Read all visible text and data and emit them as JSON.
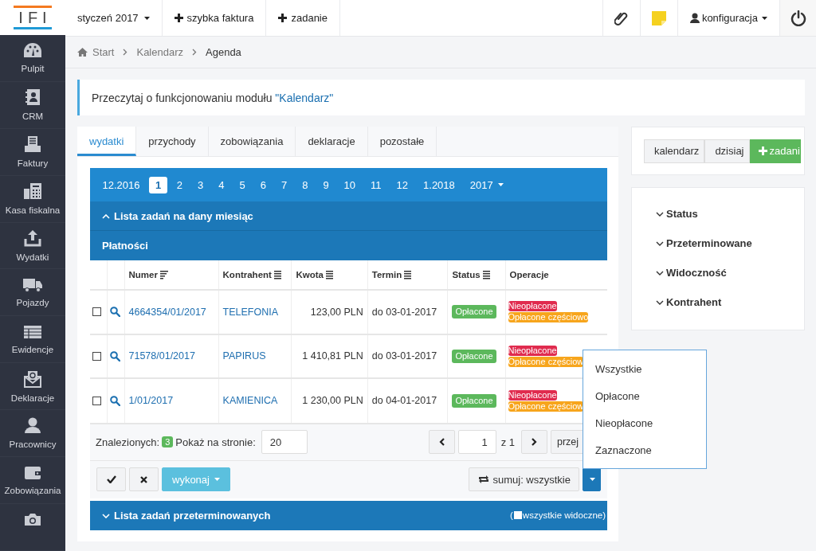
{
  "topbar": {
    "logo": "IFI",
    "month": "styczeń 2017",
    "actions": [
      "szybka faktura",
      "zadanie"
    ],
    "user": "konfiguracja"
  },
  "sidebar": {
    "items": [
      {
        "label": "Pulpit"
      },
      {
        "label": "CRM"
      },
      {
        "label": "Faktury"
      },
      {
        "label": "Kasa fiskalna"
      },
      {
        "label": "Wydatki"
      },
      {
        "label": "Pojazdy"
      },
      {
        "label": "Ewidencje"
      },
      {
        "label": "Deklaracje"
      },
      {
        "label": "Pracownicy"
      },
      {
        "label": "Zobowiązania"
      },
      {
        "kind": "cut"
      }
    ]
  },
  "breadcrumb": [
    "Start",
    "Kalendarz",
    "Agenda"
  ],
  "info": {
    "text": "Przeczytaj o funkcjonowaniu modułu ",
    "link": "\"Kalendarz\""
  },
  "tabs": [
    {
      "label": "wydatki",
      "selected": true
    },
    {
      "label": "przychody",
      "selected": false
    },
    {
      "label": "zobowiązania",
      "selected": false
    },
    {
      "label": "deklaracje",
      "selected": false
    },
    {
      "label": "pozostałe",
      "selected": false
    }
  ],
  "months": [
    {
      "label": "12.2016",
      "selected": false
    },
    {
      "label": "1",
      "selected": true
    },
    {
      "label": "2",
      "selected": false
    },
    {
      "label": "3",
      "selected": false
    },
    {
      "label": "4",
      "selected": false
    },
    {
      "label": "5",
      "selected": false
    },
    {
      "label": "6",
      "selected": false
    },
    {
      "label": "7",
      "selected": false
    },
    {
      "label": "8",
      "selected": false
    },
    {
      "label": "9",
      "selected": false
    },
    {
      "label": "10",
      "selected": false
    },
    {
      "label": "11",
      "selected": false
    },
    {
      "label": "12",
      "selected": false
    },
    {
      "label": "1.2018",
      "selected": false
    }
  ],
  "year": "2017",
  "section_title": "Lista zadań na dany miesiąc",
  "section_expanded": true,
  "subsection": "Płatności",
  "table": {
    "columns": [
      {
        "label": "Numer",
        "kind": "sorted"
      },
      {
        "label": "Kontrahent",
        "kind": "filter"
      },
      {
        "label": "Kwota",
        "kind": "filter"
      },
      {
        "label": "Termin",
        "kind": "filter"
      },
      {
        "label": "Status",
        "kind": "filter"
      },
      {
        "label": "Operacje",
        "kind": "plain"
      }
    ],
    "rows": [
      {
        "checked": false,
        "number": "4664354/01/2017",
        "contractor": "TELEFONIA",
        "amount": "123,00 PLN",
        "due": "do 03-01-2017",
        "status": "Opłacone",
        "operations": [
          {
            "label": "Nieopłacone",
            "kind": "danger"
          },
          {
            "label": "Opłacone częściowo",
            "kind": "warning"
          }
        ]
      },
      {
        "checked": false,
        "number": "71578/01/2017",
        "contractor": "PAPIRUS",
        "amount": "1 410,81 PLN",
        "due": "do 03-01-2017",
        "status": "Opłacone",
        "operations": [
          {
            "label": "Nieopłacone",
            "kind": "danger"
          },
          {
            "label": "Opłacone częściow",
            "kind": "warning"
          }
        ]
      },
      {
        "checked": false,
        "number": "1/01/2017",
        "contractor": "KAMIENICA",
        "amount": "1 230,00 PLN",
        "due": "do 04-01-2017",
        "status": "Opłacone",
        "operations": [
          {
            "label": "Nieopłacone",
            "kind": "danger"
          },
          {
            "label": "Opłacone częściow",
            "kind": "warning"
          }
        ]
      }
    ]
  },
  "footer": {
    "found_label": "Znalezionych:",
    "found": "3",
    "per_page_label": "Pokaż na stronie:",
    "per_page": "20",
    "page": "1",
    "of": "z 1",
    "go": "przej"
  },
  "actions": {
    "run": "wykonaj",
    "sum": "sumuj: wszystkie"
  },
  "overdue": {
    "title": "Lista zadań przeterminowanych",
    "expanded": false,
    "open_paren": "(",
    "all_visible": "wszystkie widoczne)",
    "all_visible_checked": false
  },
  "sum_menu": [
    "Wszystkie",
    "Opłacone",
    "Nieopłacone",
    "Zaznaczone"
  ],
  "side_buttons": [
    "kalendarz",
    "dzisiaj",
    "zadani"
  ],
  "filters": [
    {
      "label": "Status",
      "expanded": false
    },
    {
      "label": "Przeterminowane",
      "expanded": false
    },
    {
      "label": "Widoczność",
      "expanded": false
    },
    {
      "label": "Kontrahent",
      "expanded": false
    }
  ]
}
